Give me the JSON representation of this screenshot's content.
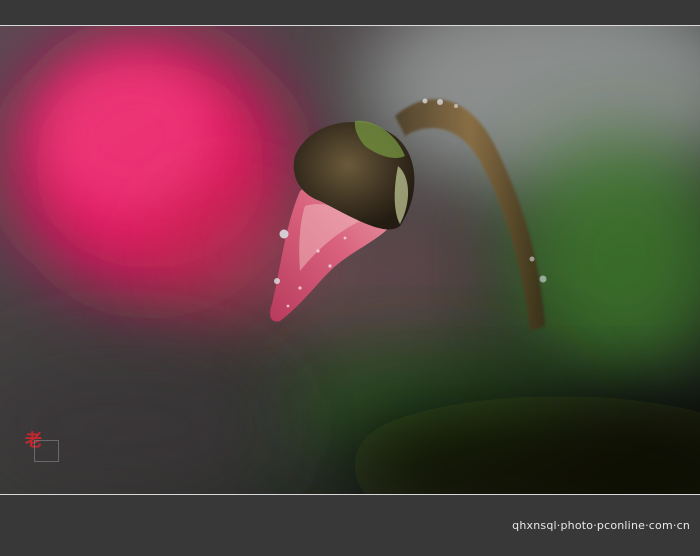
{
  "photo": {
    "subject": "flower-bud",
    "seal_text": "老"
  },
  "footer": {
    "caption": "qhxnsql·photo·pconline·com·cn"
  }
}
